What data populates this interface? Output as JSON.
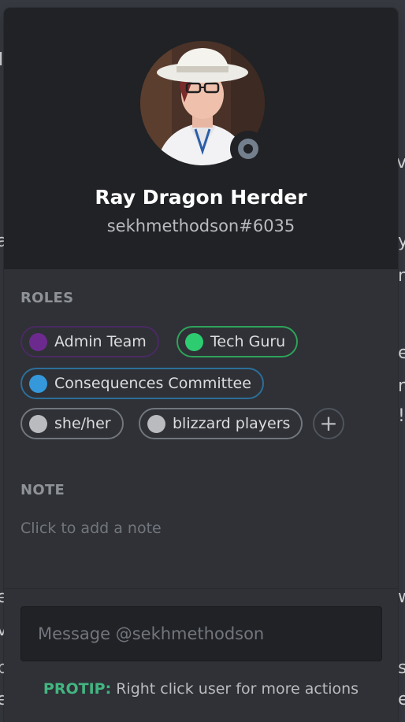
{
  "profile": {
    "display_name": "Ray Dragon Herder",
    "tag": "sekhmethodson#6035",
    "status": "offline"
  },
  "roles_section": {
    "title": "ROLES",
    "roles": [
      {
        "name": "Admin Team",
        "color": "#6c2a8f",
        "border": "#4a2a63"
      },
      {
        "name": "Tech Guru",
        "color": "#2ecc71",
        "border": "#2ea35a"
      },
      {
        "name": "Consequences Committee",
        "color": "#3498db",
        "border": "#2c6e99"
      },
      {
        "name": "she/her",
        "color": "#b9bbbe",
        "border": "#72767d"
      },
      {
        "name": "blizzard players",
        "color": "#b9bbbe",
        "border": "#72767d"
      }
    ],
    "add_icon": "plus-icon"
  },
  "note_section": {
    "title": "NOTE",
    "placeholder": "Click to add a note"
  },
  "message": {
    "placeholder": "Message @sekhmethodson"
  },
  "protip": {
    "label": "PROTIP:",
    "text": " Right click user for more actions"
  }
}
